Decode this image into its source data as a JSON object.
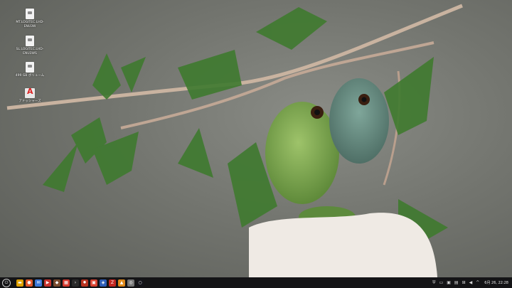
{
  "desktop": {
    "icons": [
      {
        "label": "MT.LOGITEC.LHD-\nENU3W",
        "icon": "file-icon"
      },
      {
        "label": "SL.LOGITEC.LHD-\nENU3WS",
        "icon": "file-icon"
      },
      {
        "label": "499 GB ボリューム",
        "icon": "drive-icon"
      },
      {
        "label": "アドッシャーズ",
        "icon": "app-icon"
      }
    ]
  },
  "taskbar": {
    "start_glyph": "⏻",
    "apps": [
      {
        "name": "files",
        "color": "#e0a100",
        "glyph": "▬"
      },
      {
        "name": "browser",
        "color": "#e2572b",
        "glyph": "●"
      },
      {
        "name": "mail",
        "color": "#3b78d8",
        "glyph": "✉"
      },
      {
        "name": "media",
        "color": "#c8322c",
        "glyph": "▶"
      },
      {
        "name": "tool",
        "color": "#7a4b2e",
        "glyph": "◆"
      },
      {
        "name": "calendar",
        "color": "#d43a2f",
        "glyph": "▦"
      },
      {
        "name": "terminal",
        "color": "#2a2a2a",
        "glyph": "›"
      },
      {
        "name": "settings",
        "color": "#b8321f",
        "glyph": "✹"
      },
      {
        "name": "store",
        "color": "#d8412f",
        "glyph": "▣"
      },
      {
        "name": "security",
        "color": "#2f5fb8",
        "glyph": "◈"
      },
      {
        "name": "filezilla",
        "color": "#c3261f",
        "glyph": "Z"
      },
      {
        "name": "viewer",
        "color": "#e08a1a",
        "glyph": "▲"
      },
      {
        "name": "disc",
        "color": "#777777",
        "glyph": "◎"
      },
      {
        "name": "spinner",
        "color": "#14141a",
        "glyph": "○"
      }
    ],
    "tray": {
      "clock": "6月 26, 22:28"
    }
  }
}
